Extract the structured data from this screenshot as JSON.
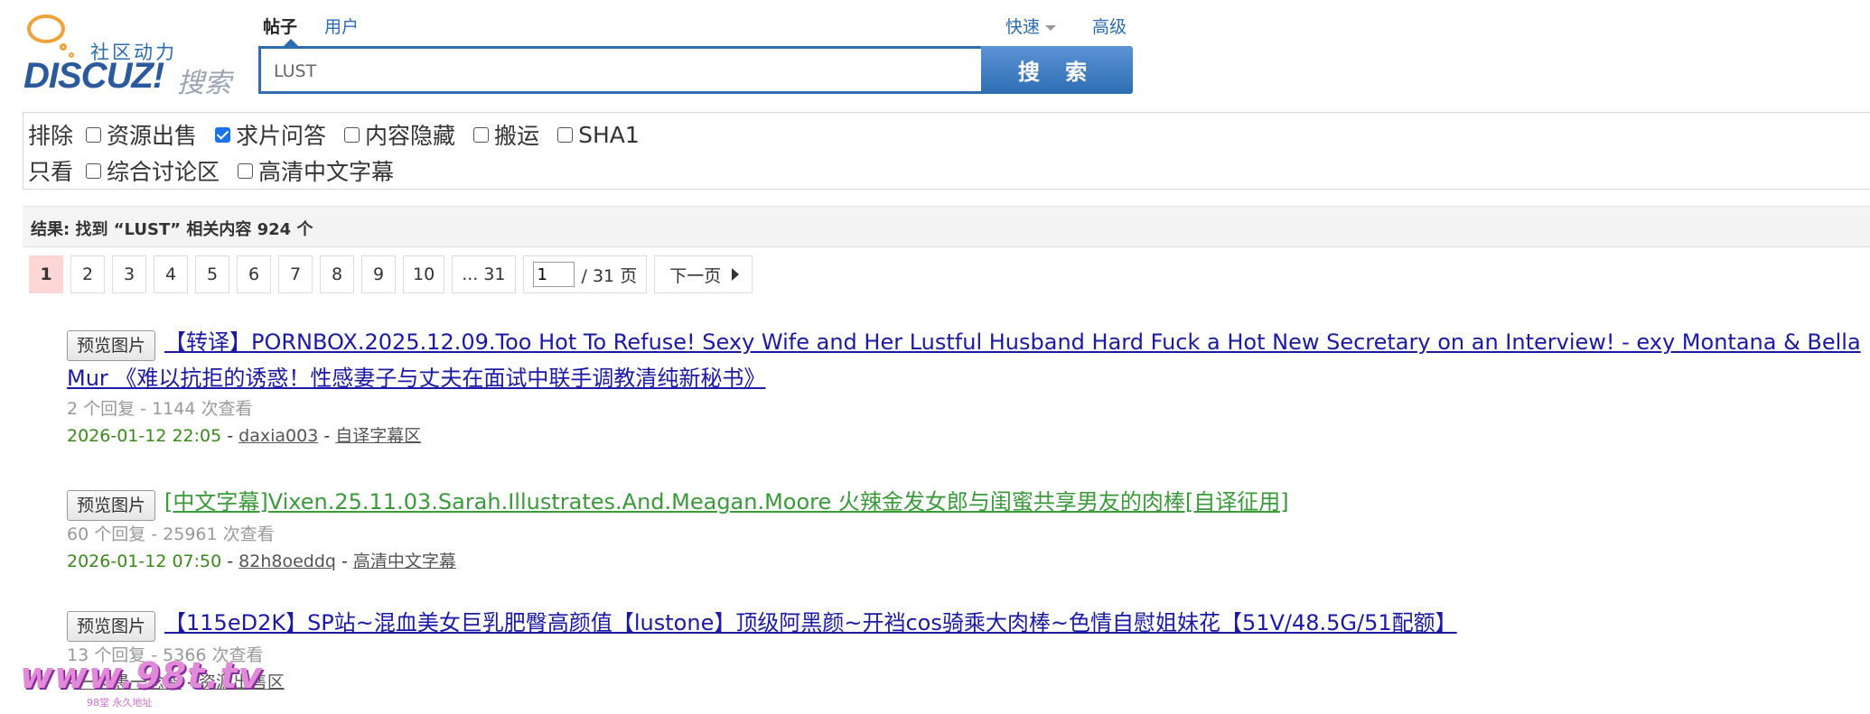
{
  "logo": {
    "tagline": "社区动力",
    "wordmark": "DISCUZ!",
    "search_word": "搜索"
  },
  "search_tabs": [
    {
      "label": "帖子",
      "active": true
    },
    {
      "label": "用户",
      "active": false
    }
  ],
  "quick_label": "快速",
  "advanced_label": "高级",
  "search": {
    "value": "LUST",
    "button_label": "搜 索"
  },
  "filters": {
    "row1_label": "排除",
    "row1_options": [
      {
        "label": "资源出售",
        "checked": false
      },
      {
        "label": "求片问答",
        "checked": true
      },
      {
        "label": "内容隐藏",
        "checked": false
      },
      {
        "label": "搬运",
        "checked": false
      },
      {
        "label": "SHA1",
        "checked": false
      }
    ],
    "row2_label": "只看",
    "row2_options": [
      {
        "label": "综合讨论区",
        "checked": false
      },
      {
        "label": "高清中文字幕",
        "checked": false
      }
    ]
  },
  "result_summary": "结果: 找到 “LUST” 相关内容 924 个",
  "pagination": {
    "pages": [
      "1",
      "2",
      "3",
      "4",
      "5",
      "6",
      "7",
      "8",
      "9",
      "10",
      "... 31"
    ],
    "current": "1",
    "jump_value": "1",
    "total_label": "/ 31 页",
    "next_label": "下一页"
  },
  "results": [
    {
      "preview_label": "预览图片",
      "title": "【转译】PORNBOX.2025.12.09.Too Hot To Refuse! Sexy Wife and Her Lustful Husband Hard Fuck a Hot New Secretary on an Interview! - exy Montana & Bella Mur 《难以抗拒的诱惑！性感妻子与丈夫在面试中联手调教清纯新秘书》",
      "title_color": "blue",
      "stats": "2 个回复 - 1144 次查看",
      "date": "2026-01-12 22:05",
      "author": "daxia003",
      "forum": "自译字幕区"
    },
    {
      "preview_label": "预览图片",
      "title": "[中文字幕]Vixen.25.11.03.Sarah.Illustrates.And.Meagan.Moore 火辣金发女郎与闺蜜共享男友的肉棒[自译征用]",
      "title_color": "green",
      "stats": "60 个回复 - 25961 次查看",
      "date": "2026-01-12 07:50",
      "author": "82h8oeddq",
      "forum": "高清中文字幕"
    },
    {
      "preview_label": "预览图片",
      "title": "【115eD2K】SP站~混血美女巨乳肥臀高颜值【lustone】顶级阿黑颜~开裆cos骑乘大肉棒~色情自慰姐妹花【51V/48.5G/51配额】",
      "title_color": "blue",
      "stats": "13 个回复 - 5366 次查看",
      "date": "",
      "author": "一念愚一念智",
      "forum": "资源出售区"
    }
  ],
  "meta_separator": " - ",
  "watermark": {
    "text": "www.98t.tv",
    "sub": "98堂 永久地址"
  },
  "colors": {
    "link_blue": "#1a1aa6",
    "link_green": "#3a9a3a",
    "brand_blue": "#2f6db3",
    "current_page": "#ffd6d6",
    "date_green": "#3a8a1a"
  }
}
